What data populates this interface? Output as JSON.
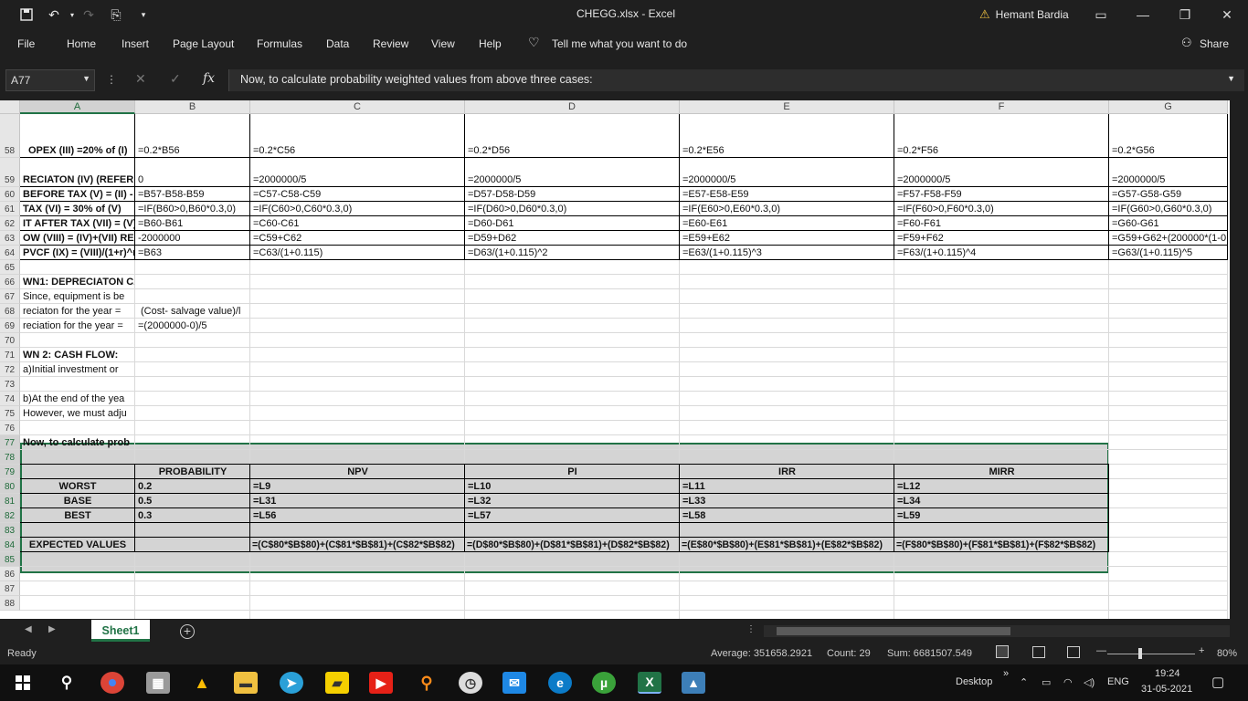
{
  "window": {
    "title": "CHEGG.xlsx  -  Excel",
    "user": "Hemant Bardia",
    "share_label": "Share"
  },
  "menu": {
    "items": [
      "File",
      "Home",
      "Insert",
      "Page Layout",
      "Formulas",
      "Data",
      "Review",
      "View",
      "Help"
    ],
    "tell_me": "Tell me what you want to do"
  },
  "formula_bar": {
    "name_box": "A77",
    "content": "Now, to calculate probability weighted values from above three cases:"
  },
  "columns": [
    "A",
    "B",
    "C",
    "D",
    "E",
    "F",
    "G"
  ],
  "rows": [
    "58",
    "59",
    "60",
    "61",
    "62",
    "63",
    "64",
    "65",
    "66",
    "67",
    "68",
    "69",
    "70",
    "71",
    "72",
    "73",
    "74",
    "75",
    "76",
    "77",
    "78",
    "79",
    "80",
    "81",
    "82",
    "83",
    "84",
    "85",
    "86",
    "87",
    "88"
  ],
  "cells": {
    "r58": {
      "A": "OPEX (III) =20% of (I)",
      "B": "=0.2*B56",
      "C": "=0.2*C56",
      "D": "=0.2*D56",
      "E": "=0.2*E56",
      "F": "=0.2*F56",
      "G": "=0.2*G56"
    },
    "r59": {
      "A": "RECIATON (IV) (REFER W",
      "B": "0",
      "C": "=2000000/5",
      "D": "=2000000/5",
      "E": "=2000000/5",
      "F": "=2000000/5",
      "G": "=2000000/5"
    },
    "r60": {
      "A": "BEFORE TAX (V) = (II) - (",
      "B": "=B57-B58-B59",
      "C": "=C57-C58-C59",
      "D": "=D57-D58-D59",
      "E": "=E57-E58-E59",
      "F": "=F57-F58-F59",
      "G": "=G57-G58-G59"
    },
    "r61": {
      "A": "TAX (VI) = 30% of (V)",
      "B": "=IF(B60>0,B60*0.3,0)",
      "C": "=IF(C60>0,C60*0.3,0)",
      "D": "=IF(D60>0,D60*0.3,0)",
      "E": "=IF(E60>0,E60*0.3,0)",
      "F": "=IF(F60>0,F60*0.3,0)",
      "G": "=IF(G60>0,G60*0.3,0)"
    },
    "r62": {
      "A": "IT AFTER TAX (VII) = (V)",
      "B": "=B60-B61",
      "C": "=C60-C61",
      "D": "=D60-D61",
      "E": "=E60-E61",
      "F": "=F60-F61",
      "G": "=G60-G61"
    },
    "r63": {
      "A": "OW (VIII) = (IV)+(VII) REF",
      "B": "-2000000",
      "C": "=C59+C62",
      "D": "=D59+D62",
      "E": "=E59+E62",
      "F": "=F59+F62",
      "G": "=G59+G62+(200000*(1-0."
    },
    "r64": {
      "A": "PVCF (IX) = (VIII)/(1+r)^n",
      "B": "=B63",
      "C": "=C63/(1+0.115)",
      "D": "=D63/(1+0.115)^2",
      "E": "=E63/(1+0.115)^3",
      "F": "=F63/(1+0.115)^4",
      "G": "=G63/(1+0.115)^5"
    },
    "r66": {
      "A": "WN1: DEPRECIATON CA"
    },
    "r67": {
      "A": "Since, equipment is be"
    },
    "r68": {
      "A": "reciaton for the year =",
      "B": "(Cost- salvage value)/l"
    },
    "r69": {
      "A": "reciation for the year =",
      "B": "=(2000000-0)/5"
    },
    "r71": {
      "A": "WN 2: CASH FLOW:"
    },
    "r72": {
      "A": "a)Initial investment or"
    },
    "r74": {
      "A": "b)At the end of the yea"
    },
    "r75": {
      "A": "However, we must adju"
    },
    "r77": {
      "A": "Now, to calculate prob"
    },
    "r79": {
      "B": "PROBABILITY",
      "C": "NPV",
      "D": "PI",
      "E": "IRR",
      "F": "MIRR"
    },
    "r80": {
      "A": "WORST",
      "B": "0.2",
      "C": "=L9",
      "D": "=L10",
      "E": "=L11",
      "F": "=L12"
    },
    "r81": {
      "A": "BASE",
      "B": "0.5",
      "C": "=L31",
      "D": "=L32",
      "E": "=L33",
      "F": "=L34"
    },
    "r82": {
      "A": "BEST",
      "B": "0.3",
      "C": "=L56",
      "D": "=L57",
      "E": "=L58",
      "F": "=L59"
    },
    "r84": {
      "A": "EXPECTED VALUES",
      "C": "=(C$80*$B$80)+(C$81*$B$81)+(C$82*$B$82)",
      "D": "=(D$80*$B$80)+(D$81*$B$81)+(D$82*$B$82)",
      "E": "=(E$80*$B$80)+(E$81*$B$81)+(E$82*$B$82)",
      "F": "=(F$80*$B$80)+(F$81*$B$81)+(F$82*$B$82)"
    }
  },
  "sheet_tab": "Sheet1",
  "status": {
    "ready": "Ready",
    "average": "Average: 351658.2921",
    "count": "Count: 29",
    "sum": "Sum: 6681507.549",
    "zoom": "80%"
  },
  "taskbar": {
    "desktop_label": "Desktop",
    "language": "ENG",
    "time": "19:24",
    "date": "31-05-2021"
  },
  "colors": {
    "excel_green": "#217346",
    "selection_fill": "#d4d4d4"
  }
}
